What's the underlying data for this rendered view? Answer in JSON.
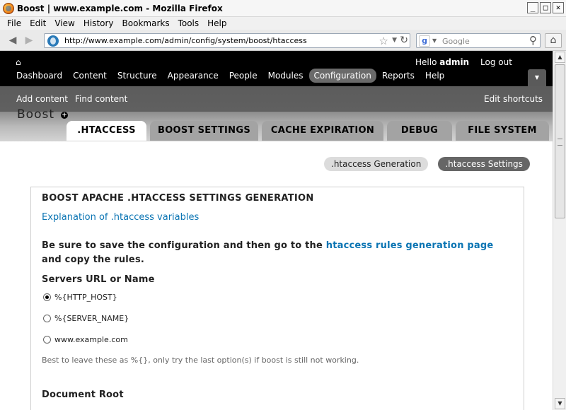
{
  "window": {
    "title": "Boost | www.example.com - Mozilla Firefox",
    "min": "_",
    "max": "□",
    "close": "✕"
  },
  "menubar": {
    "items": [
      "File",
      "Edit",
      "View",
      "History",
      "Bookmarks",
      "Tools",
      "Help"
    ]
  },
  "navbar": {
    "url": "http://www.example.com/admin/config/system/boost/htaccess",
    "search_placeholder": "Google",
    "google_glyph": "g",
    "star": "☆",
    "dropdown": "▼",
    "reload": "↻",
    "back": "◀",
    "forward": "▶",
    "magnifier": "⚲",
    "home": "⌂"
  },
  "admin": {
    "home_glyph": "⌂",
    "hello_prefix": "Hello",
    "user": "admin",
    "logout": "Log out",
    "menu": [
      "Dashboard",
      "Content",
      "Structure",
      "Appearance",
      "People",
      "Modules",
      "Configuration",
      "Reports",
      "Help"
    ],
    "active_menu": "Configuration",
    "drawer_glyph": "▼"
  },
  "shortcuts": {
    "items": [
      "Add content",
      "Find content"
    ],
    "edit": "Edit shortcuts"
  },
  "page": {
    "title": "Boost",
    "plus": "+",
    "tabs": [
      ".HTACCESS",
      "BOOST SETTINGS",
      "CACHE EXPIRATION",
      "DEBUG",
      "FILE SYSTEM"
    ],
    "active_tab": ".HTACCESS"
  },
  "subtabs": {
    "items": [
      ".htaccess Generation",
      ".htaccess Settings"
    ],
    "active": ".htaccess Settings"
  },
  "fieldset": {
    "legend": "BOOST APACHE .HTACCESS SETTINGS GENERATION",
    "explain_link": "Explanation of .htaccess variables",
    "notice_before": "Be sure to save the configuration and then go to the",
    "notice_link": "htaccess rules generation page",
    "notice_after": "and copy the rules.",
    "servers_label": "Servers URL or Name",
    "options": [
      "%{HTTP_HOST}",
      "%{SERVER_NAME}",
      "www.example.com"
    ],
    "selected": "%{HTTP_HOST}",
    "help": "Best to leave these as %{}, only try the last option(s) if boost is still not working.",
    "docroot_label": "Document Root"
  },
  "scrollbar": {
    "up": "▲",
    "down": "▼"
  }
}
